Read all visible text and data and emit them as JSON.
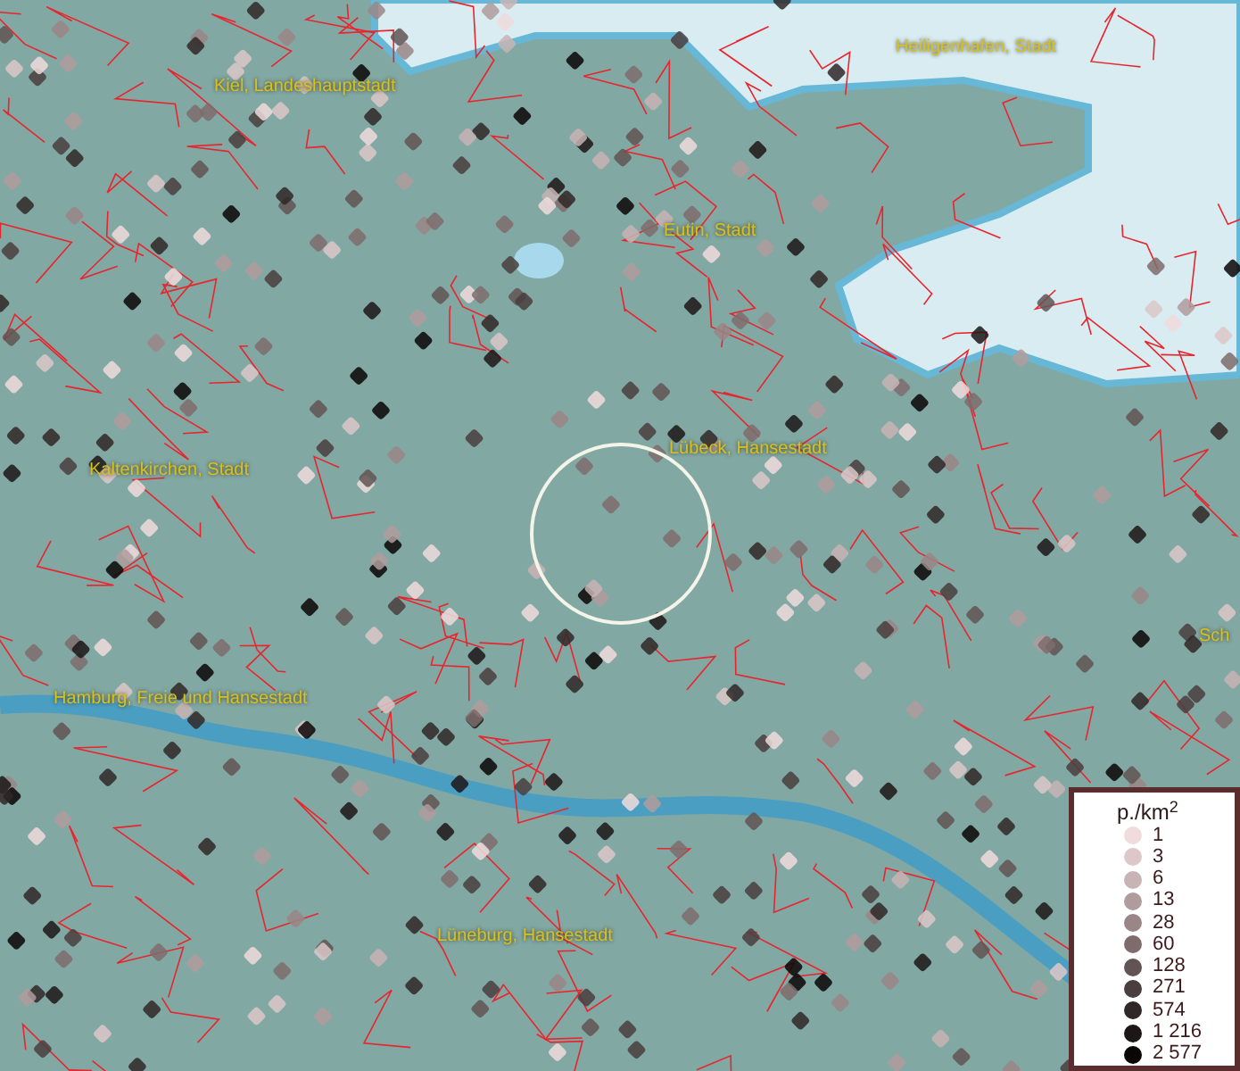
{
  "map": {
    "places": [
      {
        "kind": "city",
        "name": "Kiel, Landeshauptstadt"
      },
      {
        "kind": "city",
        "name": "Heiligenhafen, Stadt"
      },
      {
        "kind": "city",
        "name": "Eutin, Stadt"
      },
      {
        "kind": "city",
        "name": "Lübeck, Hansestadt"
      },
      {
        "kind": "city",
        "name": "Kaltenkirchen, Stadt"
      },
      {
        "kind": "city",
        "name": "Hamburg, Freie und Hansestadt"
      },
      {
        "kind": "city",
        "name": "Lüneburg, Hansestadt"
      },
      {
        "kind": "city",
        "name": "Sch"
      }
    ]
  },
  "legend": {
    "title": "p./km$^{2}$",
    "items": [
      {
        "label": "1",
        "color": "#f0dcdc"
      },
      {
        "label": "3",
        "color": "#dcc8c8"
      },
      {
        "label": "6",
        "color": "#c8b4b4"
      },
      {
        "label": "13",
        "color": "#b09c9c"
      },
      {
        "label": "28",
        "color": "#9a8686"
      },
      {
        "label": "60",
        "color": "#7e6c6c"
      },
      {
        "label": "128",
        "color": "#625454"
      },
      {
        "label": "271",
        "color": "#4a3e3e"
      },
      {
        "label": "574",
        "color": "#302828"
      },
      {
        "label": "1 216",
        "color": "#1c1616"
      },
      {
        "label": "2 577",
        "color": "#0a0606"
      }
    ]
  }
}
